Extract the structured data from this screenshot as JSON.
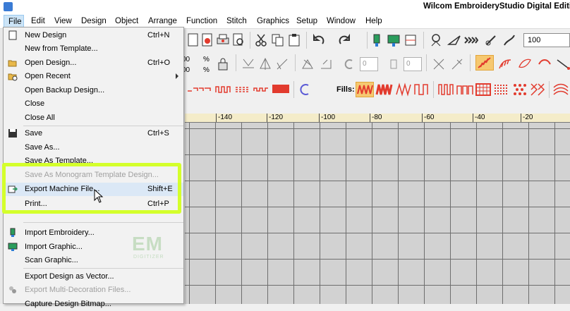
{
  "window": {
    "title": "Wilcom EmbroideryStudio Digital Edition"
  },
  "menubar": {
    "items": [
      "File",
      "Edit",
      "View",
      "Design",
      "Object",
      "Arrange",
      "Function",
      "Stitch",
      "Graphics",
      "Setup",
      "Window",
      "Help"
    ]
  },
  "file_menu": {
    "items": [
      {
        "label": "New Design",
        "shortcut": "Ctrl+N",
        "icon": "new-document-icon",
        "enabled": true
      },
      {
        "label": "New from Template...",
        "shortcut": "",
        "icon": "",
        "enabled": true
      },
      {
        "label": "Open Design...",
        "shortcut": "Ctrl+O",
        "icon": "open-folder-icon",
        "enabled": true
      },
      {
        "label": "Open Recent",
        "shortcut": "",
        "icon": "recent-folder-icon",
        "enabled": true,
        "submenu": true
      },
      {
        "label": "Open Backup Design...",
        "shortcut": "",
        "icon": "",
        "enabled": true
      },
      {
        "label": "Close",
        "shortcut": "",
        "icon": "",
        "enabled": true
      },
      {
        "label": "Close All",
        "shortcut": "",
        "icon": "",
        "enabled": true
      },
      {
        "label": "Save",
        "shortcut": "Ctrl+S",
        "icon": "save-icon",
        "enabled": true
      },
      {
        "label": "Save As...",
        "shortcut": "",
        "icon": "",
        "enabled": true
      },
      {
        "label": "Save As Template...",
        "shortcut": "",
        "icon": "",
        "enabled": true
      },
      {
        "label": "Save As Monogram Template Design...",
        "shortcut": "",
        "icon": "",
        "enabled": false
      },
      {
        "label": "Export Machine File...",
        "shortcut": "Shift+E",
        "icon": "export-machine-icon",
        "enabled": true,
        "hovered": true
      },
      {
        "label": "Print...",
        "shortcut": "Ctrl+P",
        "icon": "",
        "enabled": true
      },
      {
        "label": "Import Embroidery...",
        "shortcut": "",
        "icon": "import-embroidery-icon",
        "enabled": true
      },
      {
        "label": "Import Graphic...",
        "shortcut": "",
        "icon": "import-graphic-icon",
        "enabled": true
      },
      {
        "label": "Scan Graphic...",
        "shortcut": "",
        "icon": "",
        "enabled": true
      },
      {
        "label": "Export Design as Vector...",
        "shortcut": "",
        "icon": "",
        "enabled": true
      },
      {
        "label": "Export Multi-Decoration Files...",
        "shortcut": "",
        "icon": "multi-decoration-icon",
        "enabled": false
      },
      {
        "label": "Capture Design Bitmap...",
        "shortcut": "",
        "icon": "",
        "enabled": true
      }
    ]
  },
  "toolbar": {
    "zoom_value": "100",
    "spin_value_1": "0",
    "spin_value_2": "0",
    "fills_label": "Fills:",
    "pct_1": "%",
    "pct_2": "%",
    "frag_1": "00",
    "frag_2": "00"
  },
  "ruler": {
    "labels": [
      "-140",
      "-120",
      "-100",
      "-80",
      "-60",
      "-40",
      "-20"
    ]
  },
  "watermark": {
    "mark": "EM",
    "sub": "DIGITIZER"
  },
  "colors": {
    "highlight": "#d4ff2b",
    "fill_red": "#e23b2e",
    "menu_active": "#cce4f7"
  }
}
